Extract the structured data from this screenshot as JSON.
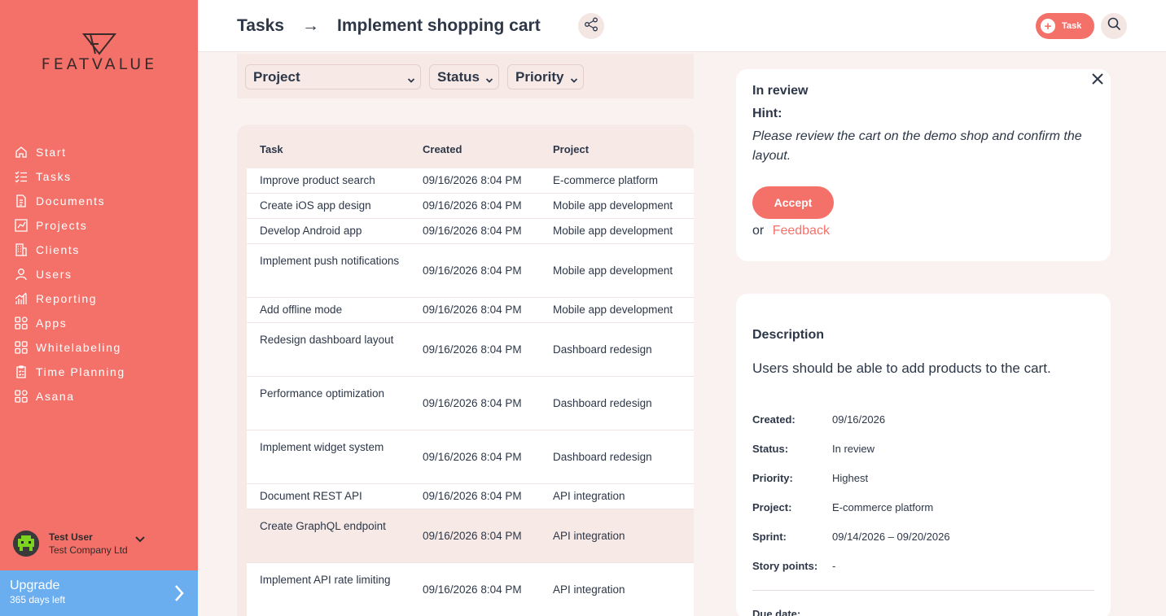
{
  "brand": {
    "name": "FEATVALUE"
  },
  "sidebar": {
    "items": [
      {
        "label": "Start",
        "icon": "home-icon"
      },
      {
        "label": "Tasks",
        "icon": "tasks-icon"
      },
      {
        "label": "Documents",
        "icon": "documents-icon"
      },
      {
        "label": "Projects",
        "icon": "projects-icon"
      },
      {
        "label": "Clients",
        "icon": "clients-icon"
      },
      {
        "label": "Users",
        "icon": "user-icon"
      },
      {
        "label": "Reporting",
        "icon": "reporting-icon"
      },
      {
        "label": "Apps",
        "icon": "apps-icon"
      },
      {
        "label": "Whitelabeling",
        "icon": "whitelabel-icon"
      },
      {
        "label": "Time Planning",
        "icon": "time-planning-icon"
      },
      {
        "label": "Asana",
        "icon": "apps-icon"
      }
    ],
    "user": {
      "name": "Test User",
      "company": "Test Company Ltd"
    },
    "upgrade": {
      "title": "Upgrade",
      "subtitle": "365 days left"
    }
  },
  "header": {
    "crumb_root": "Tasks",
    "crumb_arrow": "→",
    "crumb_current": "Implement shopping cart",
    "task_button": "Task"
  },
  "filters": {
    "project": "Project",
    "status": "Status",
    "priority": "Priority"
  },
  "table": {
    "columns": {
      "task": "Task",
      "created": "Created",
      "project": "Project"
    },
    "rows": [
      {
        "task": "Improve product search",
        "created": "09/16/2026 8:04 PM",
        "project": "E-commerce platform"
      },
      {
        "task": "Create iOS app design",
        "created": "09/16/2026 8:04 PM",
        "project": "Mobile app development"
      },
      {
        "task": "Develop Android app",
        "created": "09/16/2026 8:04 PM",
        "project": "Mobile app development"
      },
      {
        "task": "Implement push notifications",
        "created": "09/16/2026 8:04 PM",
        "project": "Mobile app development"
      },
      {
        "task": "Add offline mode",
        "created": "09/16/2026 8:04 PM",
        "project": "Mobile app development"
      },
      {
        "task": "Redesign dashboard layout",
        "created": "09/16/2026 8:04 PM",
        "project": "Dashboard redesign"
      },
      {
        "task": "Performance optimization",
        "created": "09/16/2026 8:04 PM",
        "project": "Dashboard redesign"
      },
      {
        "task": "Implement widget system",
        "created": "09/16/2026 8:04 PM",
        "project": "Dashboard redesign"
      },
      {
        "task": "Document REST API",
        "created": "09/16/2026 8:04 PM",
        "project": "API integration"
      },
      {
        "task": "Create GraphQL endpoint",
        "created": "09/16/2026 8:04 PM",
        "project": "API integration"
      },
      {
        "task": "Implement API rate limiting",
        "created": "09/16/2026 8:04 PM",
        "project": "API integration"
      }
    ]
  },
  "review": {
    "status": "In review",
    "hint_label": "Hint:",
    "hint_text": "Please review the cart on the demo shop and confirm the layout.",
    "accept": "Accept",
    "or": "or",
    "feedback": "Feedback"
  },
  "details": {
    "title": "Description",
    "text": "Users should be able to add products to the cart.",
    "meta": [
      {
        "key": "Created:",
        "value": "09/16/2026"
      },
      {
        "key": "Status:",
        "value": "In review"
      },
      {
        "key": "Priority:",
        "value": "Highest"
      },
      {
        "key": "Project:",
        "value": "E-commerce platform"
      },
      {
        "key": "Sprint:",
        "value": "09/14/2026 – 09/20/2026"
      },
      {
        "key": "Story points:",
        "value": "-"
      }
    ],
    "due_label": "Due date:"
  },
  "colors": {
    "accent": "#f4716a",
    "upgrade": "#6aaef0",
    "text": "#2d3748"
  }
}
